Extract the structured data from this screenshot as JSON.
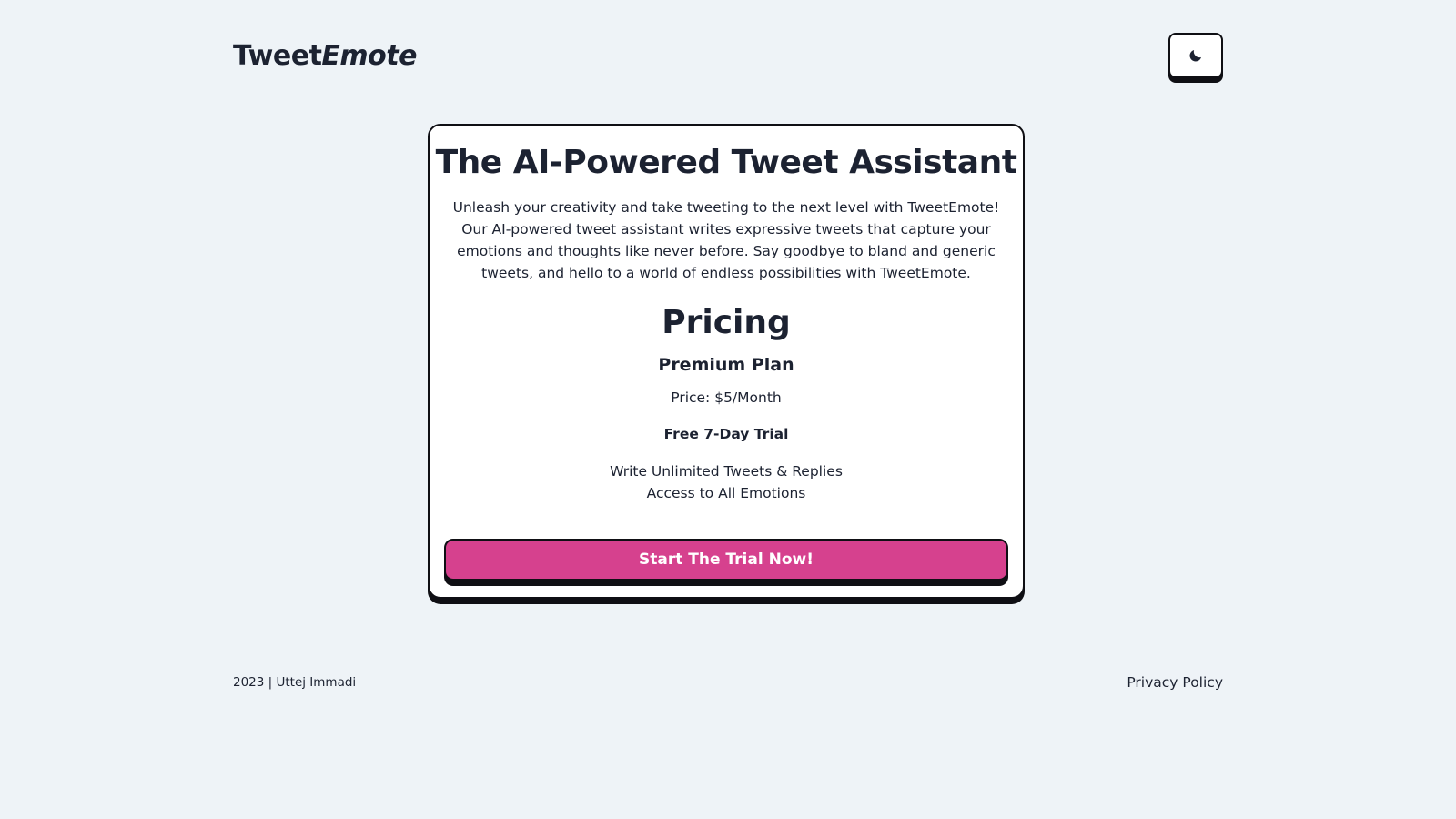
{
  "header": {
    "logo_primary": "Tweet",
    "logo_accent": "Emote",
    "theme_toggle_icon": "moon-icon"
  },
  "card": {
    "title": "The AI-Powered Tweet Assistant",
    "description": "Unleash your creativity and take tweeting to the next level with TweetEmote! Our AI-powered tweet assistant writes expressive tweets that capture your emotions and thoughts like never before. Say goodbye to bland and generic tweets, and hello to a world of endless possibilities with TweetEmote.",
    "pricing_title": "Pricing",
    "plan_name": "Premium Plan",
    "price": "Price: $5/Month",
    "trial": "Free 7-Day Trial",
    "features": [
      "Write Unlimited Tweets & Replies",
      "Access to All Emotions"
    ],
    "cta_label": "Start The Trial Now!"
  },
  "footer": {
    "copyright": "2023 | Uttej Immadi",
    "privacy_link": "Privacy Policy"
  },
  "colors": {
    "background": "#eef3f7",
    "text": "#1c2231",
    "accent": "#d6418e",
    "border": "#0f0f14"
  }
}
